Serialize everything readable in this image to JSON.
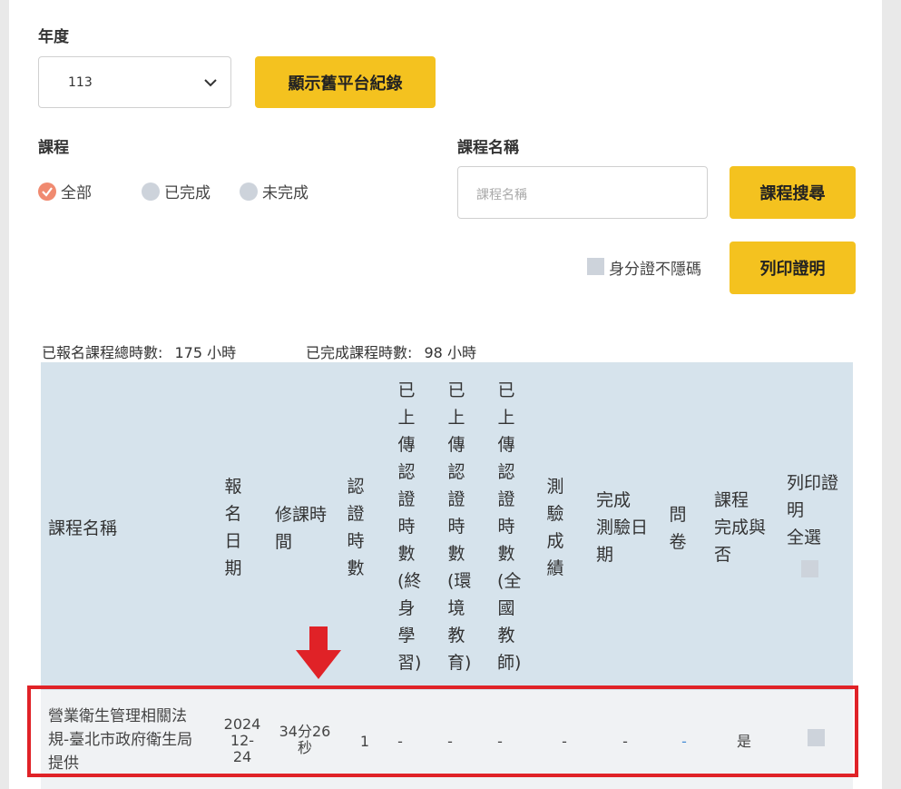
{
  "year": {
    "label": "年度",
    "value": "113"
  },
  "show_old_button": "顯示舊平台紀錄",
  "course_filter": {
    "label": "課程",
    "options": [
      "全部",
      "已完成",
      "未完成"
    ],
    "selected": "全部"
  },
  "course_name": {
    "label": "課程名稱",
    "placeholder": "課程名稱"
  },
  "search_button": "課程搜尋",
  "id_unmask_label": "身分證不隱碼",
  "print_button": "列印證明",
  "stats": {
    "total_label": "已報名課程總時數:",
    "total_value": "175 小時",
    "done_label": "已完成課程時數:",
    "done_value": "98 小時"
  },
  "table": {
    "headers": {
      "course_name": "課程名稱",
      "enroll_date": [
        "報",
        "名",
        "日",
        "期"
      ],
      "study_time": [
        "修課時",
        "間"
      ],
      "cert_hours": [
        "認",
        "證",
        "時",
        "數"
      ],
      "upload_lifelong": [
        "已",
        "上",
        "傳",
        "認",
        "證",
        "時",
        "數",
        "(終",
        "身",
        "學",
        "習)"
      ],
      "upload_env": [
        "已",
        "上",
        "傳",
        "認",
        "證",
        "時",
        "數",
        "(環",
        "境",
        "教",
        "育)"
      ],
      "upload_teacher": [
        "已",
        "上",
        "傳",
        "認",
        "證",
        "時",
        "數",
        "(全",
        "國",
        "教",
        "師)"
      ],
      "test_score": [
        "測",
        "驗",
        "成",
        "績"
      ],
      "test_date": [
        "完成",
        "測驗日",
        "期"
      ],
      "survey": [
        "問",
        "卷"
      ],
      "completed": [
        "課程",
        "完成與",
        "否"
      ],
      "print_all": [
        "列印證",
        "明",
        "全選"
      ]
    },
    "rows": [
      {
        "course_name": [
          "營業衛生管理相關法",
          "規-臺北市政府衛生局",
          "提供"
        ],
        "enroll_date": [
          "2024",
          "12-",
          "24"
        ],
        "study_time": [
          "34分26",
          "秒"
        ],
        "cert_hours": "1",
        "upload_lifelong": "-",
        "upload_env": "-",
        "upload_teacher": "-",
        "test_score": "-",
        "test_date": "-",
        "survey": "-",
        "completed": "是"
      }
    ]
  },
  "colors": {
    "accent_yellow": "#f4c21f",
    "header_bg": "#d6e3ec",
    "highlight_red": "#e02227",
    "radio_selected": "#f08a70"
  }
}
